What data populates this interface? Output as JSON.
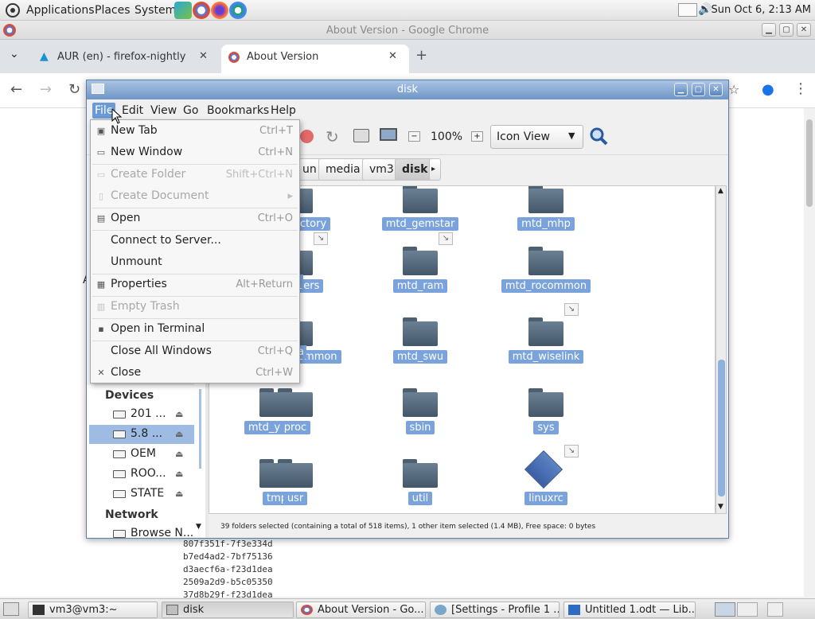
{
  "top_panel": {
    "applications": "Applications",
    "places": "Places",
    "system": "System",
    "clock": "Sun Oct  6,  2:13 AM"
  },
  "chrome": {
    "window_title": "About Version - Google Chrome",
    "tabs": [
      {
        "label": "AUR (en) - firefox-nightly"
      },
      {
        "label": "About Version"
      }
    ],
    "hash_lines": [
      "807f351f-7f3e334d",
      "b7ed4ad2-7bf75136",
      "d3aecf6a-f23d1dea",
      "2509a2d9-b5c05350",
      "37d8b29f-f23d1dea"
    ]
  },
  "file_manager": {
    "title": "disk",
    "menubar": [
      "File",
      "Edit",
      "View",
      "Go",
      "Bookmarks",
      "Help"
    ],
    "zoom": "100%",
    "view_mode": "Icon View",
    "path": [
      "un",
      "media",
      "vm3",
      "disk"
    ],
    "sidebar": {
      "devices_header": "Devices",
      "devices": [
        {
          "label": "201 ...",
          "selected": false
        },
        {
          "label": "5.8 ...",
          "selected": true
        },
        {
          "label": "OEM",
          "selected": false
        },
        {
          "label": "ROO...",
          "selected": false
        },
        {
          "label": "STATE",
          "selected": false
        }
      ],
      "network_header": "Network",
      "network": [
        {
          "label": "Browse N..."
        }
      ]
    },
    "files": [
      {
        "name": "mtd_factory",
        "link": false
      },
      {
        "name": "mtd_gemstar",
        "link": false
      },
      {
        "name": "mtd_mhp",
        "link": false
      },
      {
        "name": "mtd_pers",
        "link": true
      },
      {
        "name": "mtd_ram",
        "link": true
      },
      {
        "name": "mtd_rocommon",
        "link": false
      },
      {
        "name": "mtd_rwcommon",
        "link": false
      },
      {
        "name": "mtd_swu",
        "link": false
      },
      {
        "name": "mtd_wiselink",
        "link": true
      },
      {
        "name": "mtd_yahoo",
        "link": false
      },
      {
        "name": "proc",
        "link": false
      },
      {
        "name": "sbin",
        "link": false
      },
      {
        "name": "sys",
        "link": false
      },
      {
        "name": "tmp",
        "link": false
      },
      {
        "name": "usr",
        "link": false
      },
      {
        "name": "util",
        "link": false
      },
      {
        "name": "linuxrc",
        "link": true
      }
    ],
    "partial_labels": [
      "l",
      "a"
    ],
    "status": "39 folders selected (containing a total of 518 items), 1 other item selected (1.4 MB), Free space: 0 bytes"
  },
  "file_menu": [
    {
      "label": "New Tab",
      "accel": "Ctrl+T",
      "disabled": false,
      "icon": "new-tab-icon"
    },
    {
      "label": "New Window",
      "accel": "Ctrl+N",
      "disabled": false,
      "icon": "new-window-icon"
    },
    {
      "label": "Create Folder",
      "accel": "Shift+Ctrl+N",
      "disabled": true,
      "icon": "create-folder-icon"
    },
    {
      "label": "Create Document",
      "accel": "▸",
      "disabled": true,
      "icon": "create-document-icon"
    },
    {
      "label": "Open",
      "accel": "Ctrl+O",
      "disabled": false,
      "icon": "open-icon"
    },
    {
      "label": "Connect to Server...",
      "accel": "",
      "disabled": false,
      "icon": ""
    },
    {
      "label": "Unmount",
      "accel": "",
      "disabled": false,
      "icon": ""
    },
    {
      "label": "Properties",
      "accel": "Alt+Return",
      "disabled": false,
      "icon": "properties-icon"
    },
    {
      "label": "Empty Trash",
      "accel": "",
      "disabled": true,
      "icon": "trash-icon"
    },
    {
      "label": "Open in Terminal",
      "accel": "",
      "disabled": false,
      "icon": "terminal-icon"
    },
    {
      "label": "Close All Windows",
      "accel": "Ctrl+Q",
      "disabled": false,
      "icon": ""
    },
    {
      "label": "Close",
      "accel": "Ctrl+W",
      "disabled": false,
      "icon": "close-icon"
    }
  ],
  "taskbar": [
    {
      "label": "vm3@vm3:~",
      "icon": "terminal-icon"
    },
    {
      "label": "disk",
      "icon": "folder-icon"
    },
    {
      "label": "About Version - Go...",
      "icon": "chrome-icon"
    },
    {
      "label": "[Settings - Profile 1 ...",
      "icon": "browser-icon"
    },
    {
      "label": "Untitled 1.odt — Lib...",
      "icon": "writer-icon"
    }
  ],
  "colors": {
    "selection": "#7aa3dc",
    "titlebar": "#6f96c6",
    "folder": "#4d6072"
  }
}
